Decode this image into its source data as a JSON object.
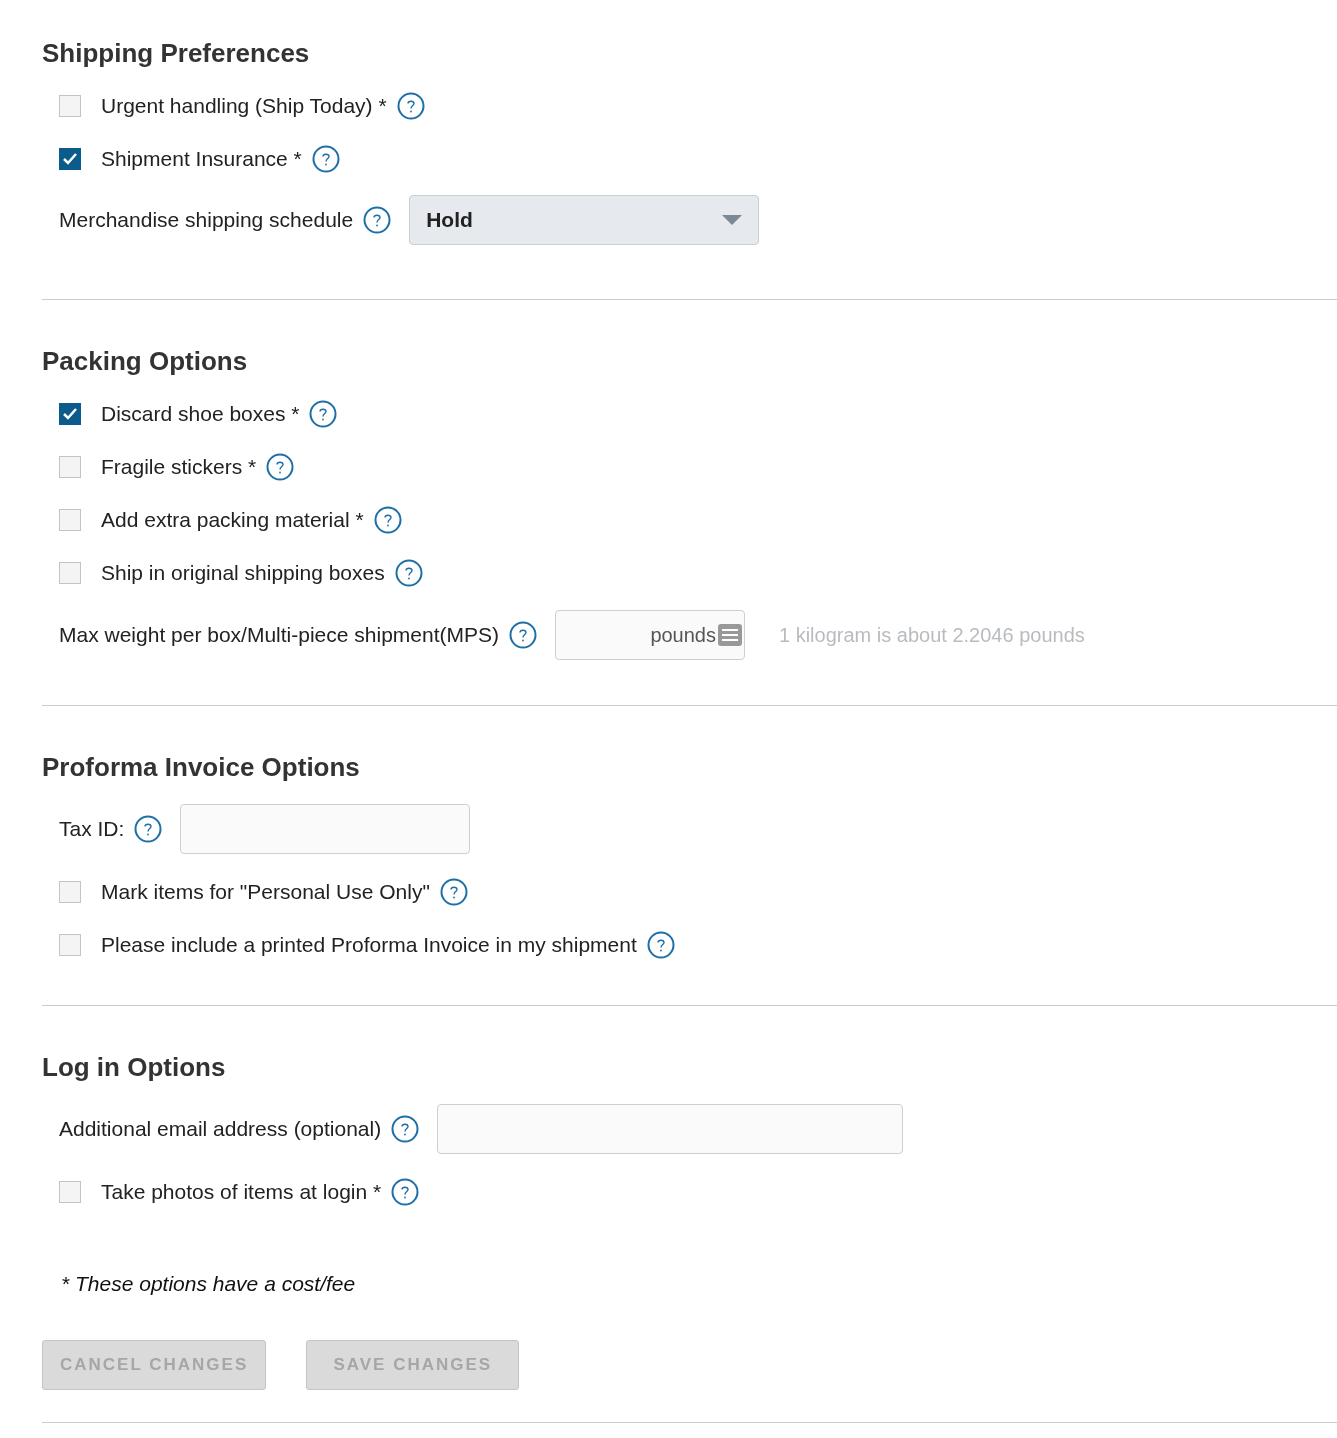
{
  "sections": [
    {
      "title": "Shipping Preferences",
      "items": [
        {
          "kind": "checkbox",
          "label": "Urgent handling (Ship Today) *",
          "checked": false
        },
        {
          "kind": "checkbox",
          "label": "Shipment Insurance *",
          "checked": true
        },
        {
          "kind": "select",
          "label": "Merchandise shipping schedule",
          "value": "Hold"
        }
      ]
    },
    {
      "title": "Packing Options",
      "items": [
        {
          "kind": "checkbox",
          "label": "Discard shoe boxes *",
          "checked": true
        },
        {
          "kind": "checkbox",
          "label": "Fragile stickers *",
          "checked": false
        },
        {
          "kind": "checkbox",
          "label": "Add extra packing material *",
          "checked": false
        },
        {
          "kind": "checkbox",
          "label": "Ship in original shipping boxes",
          "checked": false
        },
        {
          "kind": "number-input",
          "label": "Max weight per box/Multi-piece shipment(MPS)",
          "placeholder": "pounds",
          "hint": "1 kilogram is about 2.2046 pounds"
        }
      ]
    },
    {
      "title": "Proforma Invoice Options",
      "items": [
        {
          "kind": "text-input",
          "label": "Tax ID:"
        },
        {
          "kind": "checkbox",
          "label": "Mark items for \"Personal Use Only\"",
          "checked": false
        },
        {
          "kind": "checkbox",
          "label": "Please include a printed Proforma Invoice in my shipment",
          "checked": false
        }
      ]
    },
    {
      "title": "Log in Options",
      "items": [
        {
          "kind": "email-input",
          "label": "Additional email address (optional)"
        },
        {
          "kind": "checkbox",
          "label": "Take photos of items at login *",
          "checked": false
        }
      ]
    }
  ],
  "footnote": "* These options have a cost/fee",
  "buttons": [
    {
      "label": "CANCEL CHANGES",
      "disabled": true
    },
    {
      "label": "SAVE CHANGES",
      "disabled": true
    }
  ]
}
